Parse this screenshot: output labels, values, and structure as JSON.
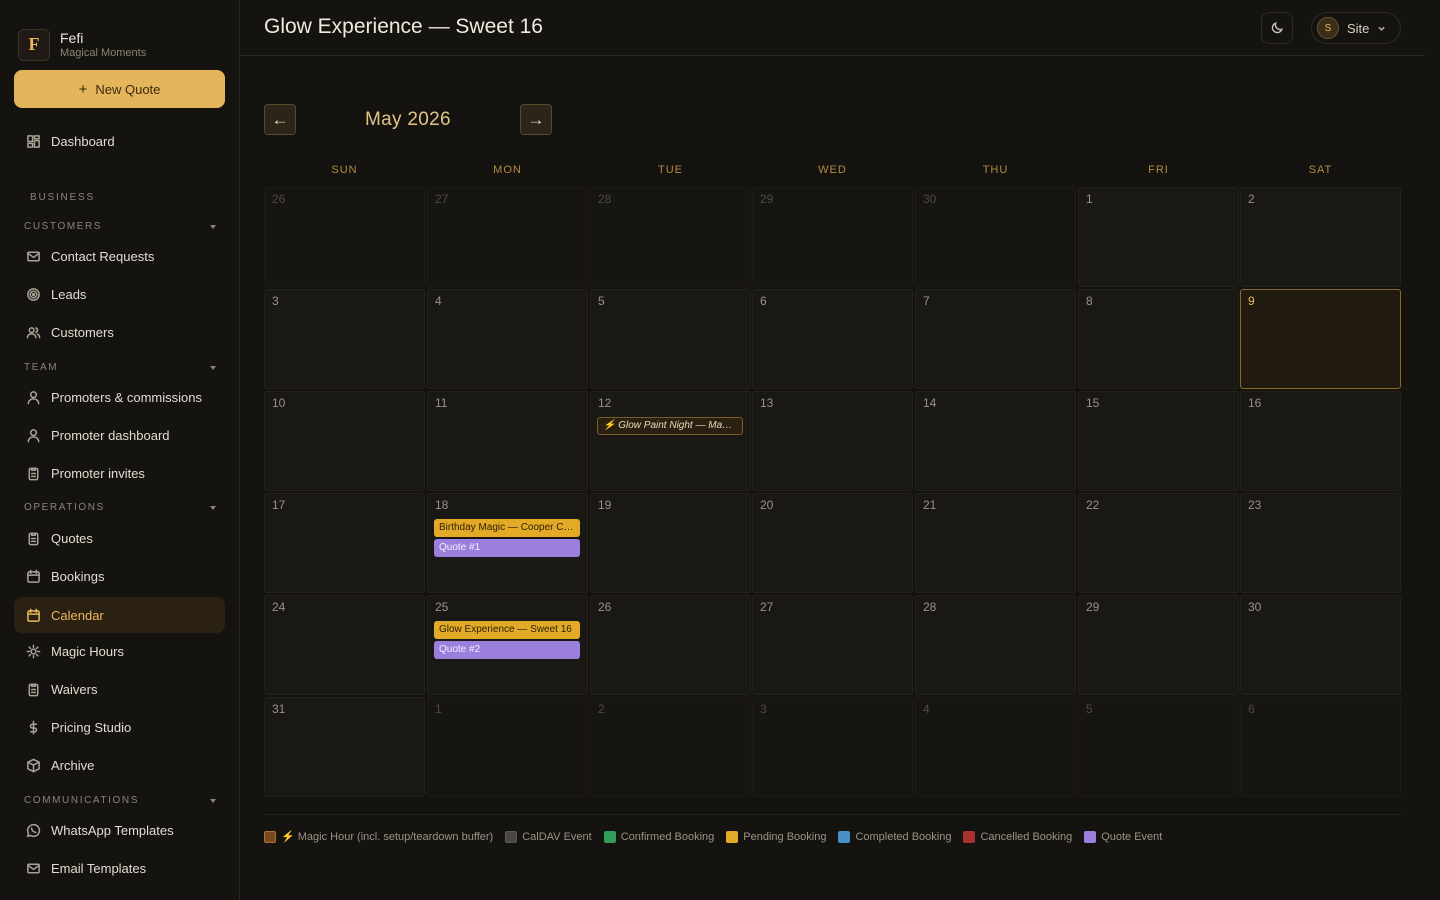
{
  "brand": {
    "logo_letter": "F",
    "name": "Fefi",
    "subtitle": "Magical Moments"
  },
  "sidebar": {
    "new_quote_label": "New Quote",
    "dashboard_label": "Dashboard",
    "business_label": "BUSINESS",
    "groups": {
      "customers": "CUSTOMERS",
      "team": "TEAM",
      "operations": "OPERATIONS",
      "communications": "COMMUNICATIONS"
    },
    "items": {
      "contact_requests": "Contact Requests",
      "leads": "Leads",
      "customers": "Customers",
      "promoters_commissions": "Promoters & commissions",
      "promoter_dashboard": "Promoter dashboard",
      "promoter_invites": "Promoter invites",
      "quotes": "Quotes",
      "bookings": "Bookings",
      "calendar": "Calendar",
      "magic_hours": "Magic Hours",
      "waivers": "Waivers",
      "pricing_studio": "Pricing Studio",
      "archive": "Archive",
      "whatsapp_templates": "WhatsApp Templates",
      "email_templates": "Email Templates"
    },
    "active_item": "calendar"
  },
  "header": {
    "title": "Glow Experience — Sweet 16",
    "site_avatar_letter": "S",
    "site_label": "Site"
  },
  "calendar": {
    "month_label": "May 2026",
    "prev_arrow": "←",
    "next_arrow": "→",
    "weekdays": [
      "SUN",
      "MON",
      "TUE",
      "WED",
      "THU",
      "FRI",
      "SAT"
    ],
    "today": 9,
    "weeks": [
      [
        {
          "d": "26",
          "out": true
        },
        {
          "d": "27",
          "out": true
        },
        {
          "d": "28",
          "out": true
        },
        {
          "d": "29",
          "out": true
        },
        {
          "d": "30",
          "out": true
        },
        {
          "d": "1"
        },
        {
          "d": "2"
        }
      ],
      [
        {
          "d": "3"
        },
        {
          "d": "4"
        },
        {
          "d": "5"
        },
        {
          "d": "6"
        },
        {
          "d": "7"
        },
        {
          "d": "8"
        },
        {
          "d": "9",
          "today": true
        }
      ],
      [
        {
          "d": "10"
        },
        {
          "d": "11"
        },
        {
          "d": "12",
          "events": [
            {
              "type": "magic",
              "label": "⚡ Glow Paint Night — Ma…"
            }
          ]
        },
        {
          "d": "13"
        },
        {
          "d": "14"
        },
        {
          "d": "15"
        },
        {
          "d": "16"
        }
      ],
      [
        {
          "d": "17"
        },
        {
          "d": "18",
          "events": [
            {
              "type": "pending",
              "label": "Birthday Magic — Cooper C…"
            },
            {
              "type": "quote",
              "label": "Quote #1"
            }
          ]
        },
        {
          "d": "19"
        },
        {
          "d": "20"
        },
        {
          "d": "21"
        },
        {
          "d": "22"
        },
        {
          "d": "23"
        }
      ],
      [
        {
          "d": "24"
        },
        {
          "d": "25",
          "events": [
            {
              "type": "pending",
              "label": "Glow Experience — Sweet 16"
            },
            {
              "type": "quote",
              "label": "Quote #2"
            }
          ]
        },
        {
          "d": "26"
        },
        {
          "d": "27"
        },
        {
          "d": "28"
        },
        {
          "d": "29"
        },
        {
          "d": "30"
        }
      ],
      [
        {
          "d": "31"
        },
        {
          "d": "1",
          "out": true
        },
        {
          "d": "2",
          "out": true
        },
        {
          "d": "3",
          "out": true
        },
        {
          "d": "4",
          "out": true
        },
        {
          "d": "5",
          "out": true
        },
        {
          "d": "6",
          "out": true
        }
      ]
    ]
  },
  "legend": [
    {
      "label": "⚡ Magic Hour (incl. setup/teardown buffer)",
      "color": "#7a4a1c",
      "border": "#b07030"
    },
    {
      "label": "CalDAV Event",
      "color": "#4a4740",
      "border": "#5a574f"
    },
    {
      "label": "Confirmed Booking",
      "color": "#2f9e5a",
      "border": "#2f9e5a"
    },
    {
      "label": "Pending Booking",
      "color": "#e2aa26",
      "border": "#e2aa26"
    },
    {
      "label": "Completed Booking",
      "color": "#4a90c8",
      "border": "#4a90c8"
    },
    {
      "label": "Cancelled Booking",
      "color": "#a83232",
      "border": "#a83232"
    },
    {
      "label": "Quote Event",
      "color": "#9a7fdd",
      "border": "#9a7fdd"
    }
  ],
  "colors": {
    "accent": "#e4b55a",
    "background": "#15130f",
    "pending": "#e2aa26",
    "quote": "#9a7fdd"
  }
}
